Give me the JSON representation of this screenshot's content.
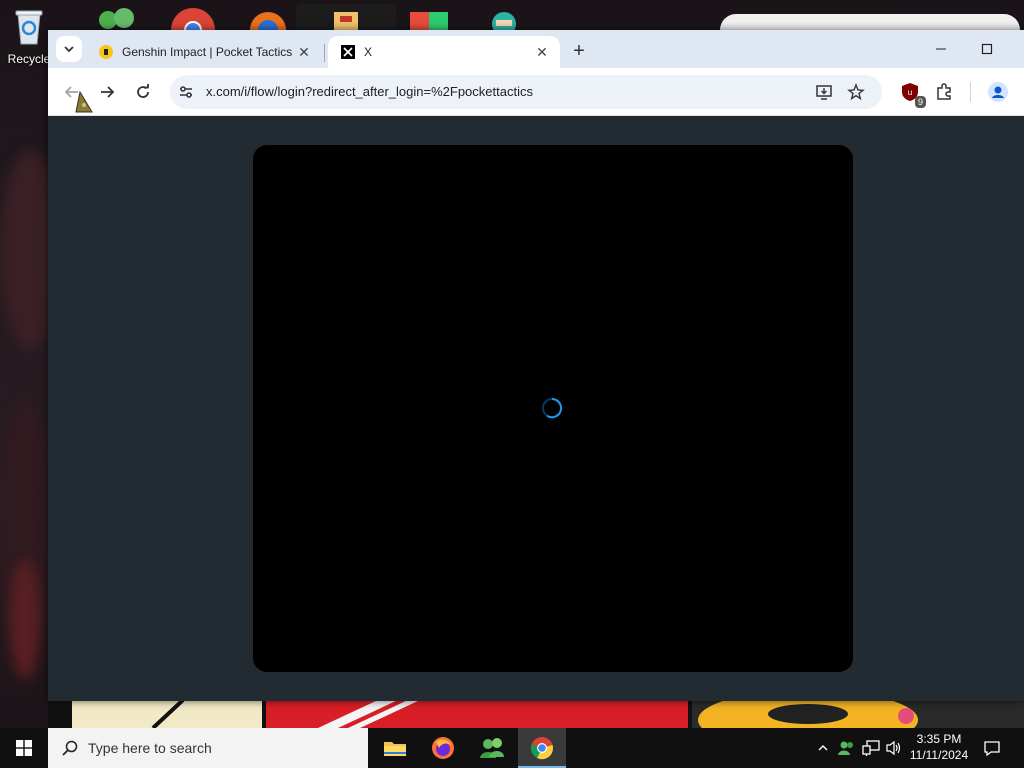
{
  "desktop": {
    "recycle_bin_label": "Recycle",
    "icons": [
      "recycle-bin-icon",
      "people-icon",
      "chrome-icon",
      "browser-icon",
      "app-icon",
      "shield-app-icon",
      "character-icon"
    ]
  },
  "browser": {
    "tabs": [
      {
        "title": "Genshin Impact | Pocket Tactics",
        "favicon": "pocket-tactics-favicon",
        "active": false
      },
      {
        "title": "X",
        "favicon": "x-favicon",
        "active": true
      }
    ],
    "address_bar": {
      "url": "x.com/i/flow/login?redirect_after_login=%2Fpockettactics"
    },
    "extensions_badge": "9",
    "page": {
      "state": "loading",
      "background_color": "#222b32",
      "modal_color": "#000000",
      "spinner_color": "#1d9bf0"
    }
  },
  "taskbar": {
    "search_placeholder": "Type here to search",
    "apps": [
      "file-explorer-icon",
      "firefox-icon",
      "people-app-icon",
      "chrome-icon"
    ],
    "active_app": "chrome-icon",
    "time": "3:35 PM",
    "date": "11/11/2024"
  }
}
